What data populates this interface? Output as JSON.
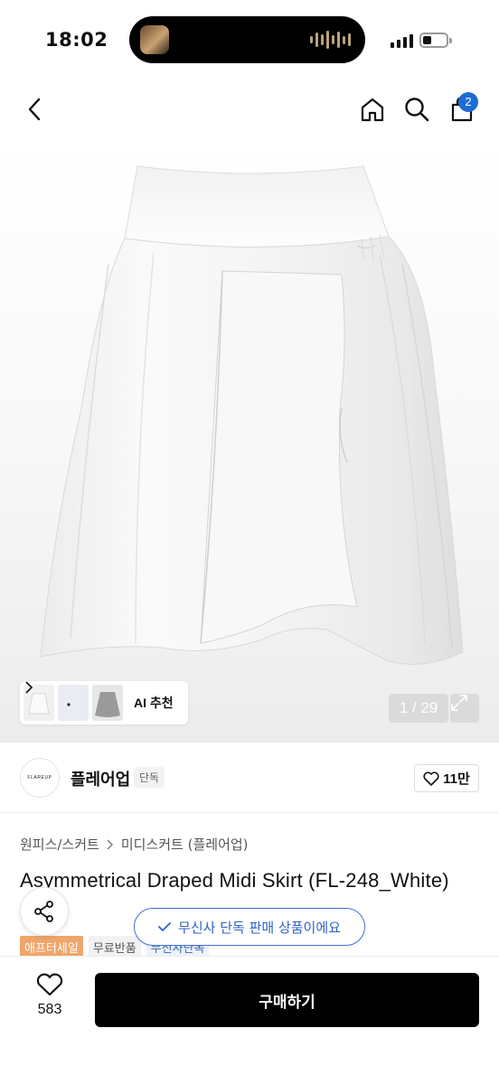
{
  "status_bar": {
    "time": "18:02"
  },
  "nav": {
    "back_icon": "chevron-left-icon",
    "home_icon": "home-icon",
    "search_icon": "search-icon",
    "cart_icon": "shopping-bag-icon",
    "cart_count": "2"
  },
  "gallery": {
    "ai_recommend_label": "AI 추천",
    "counter": "1 / 29",
    "current_index": 1,
    "total": 29
  },
  "brand": {
    "logo_text": "FLAREUP",
    "name": "플레어업",
    "exclusive_tag": "단독",
    "like_count": "11만"
  },
  "product": {
    "breadcrumb": [
      "원피스/스커트",
      "미디스커트 (플레어업)"
    ],
    "title": "Asymmetrical Draped Midi Skirt (FL-248_White)",
    "tags": [
      "애프터세일",
      "무료반품",
      "무신사단독"
    ]
  },
  "toast": {
    "message": "무신사 단독 판매 상품이에요"
  },
  "bottom_bar": {
    "wishlist_count": "583",
    "buy_label": "구매하기"
  },
  "colors": {
    "accent_blue": "#1e6bd6",
    "sale_tag": "#f0a66b",
    "buy_button": "#000000"
  }
}
